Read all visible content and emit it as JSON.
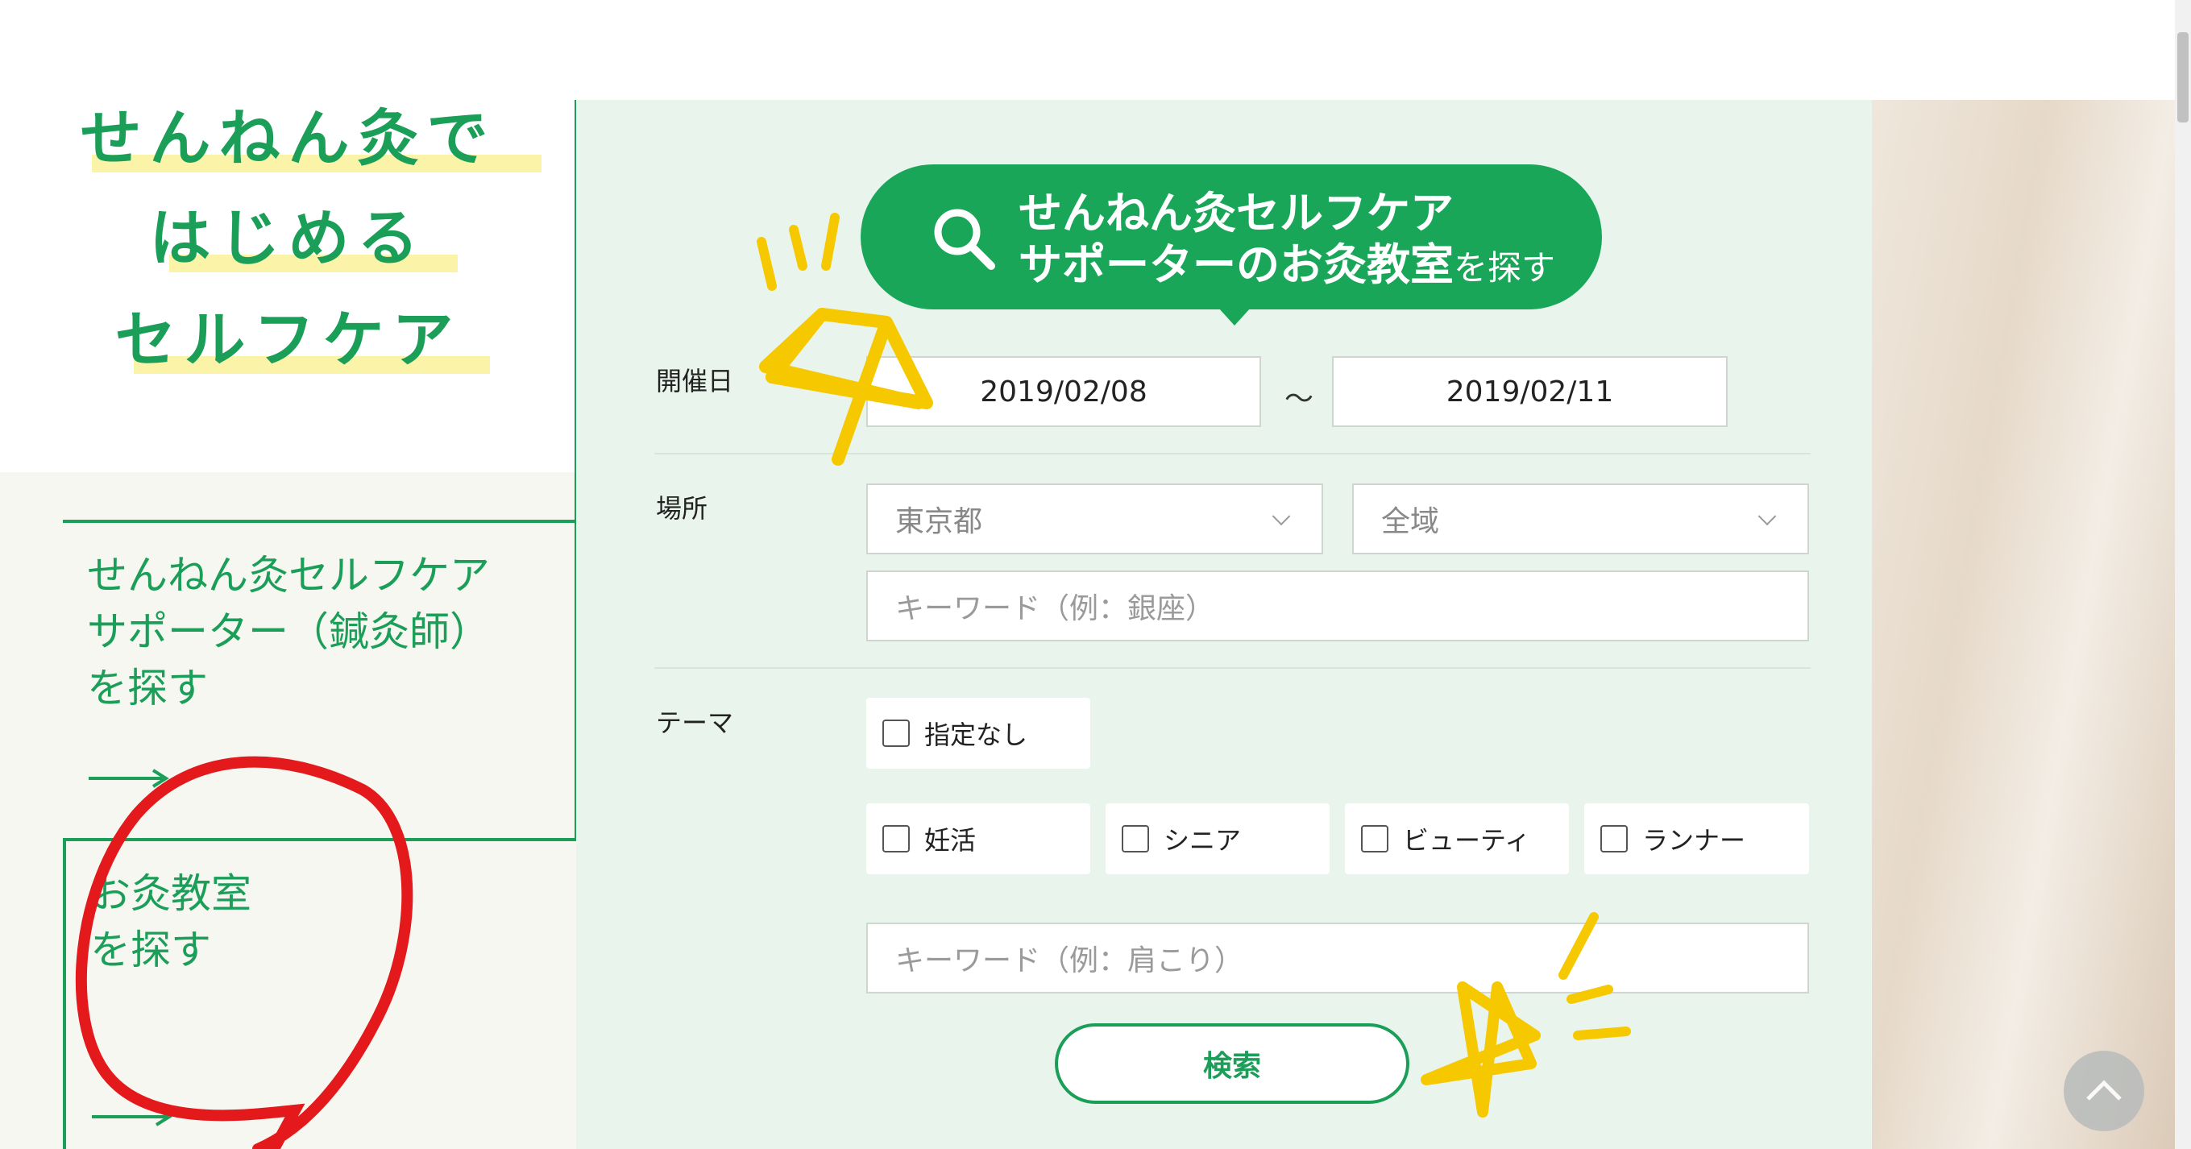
{
  "brand": {
    "line1": "せんねん灸で",
    "line2": "はじめる",
    "line3": "セルフケア"
  },
  "nav": {
    "supporter_link": "せんねん灸セルフケア\nサポーター（鍼灸師）\nを探す",
    "classroom_link": "お灸教室\nを探す"
  },
  "search_header": {
    "line1": "せんねん灸セルフケア",
    "line2": "サポーターのお灸教室",
    "line2_suffix": "を探す"
  },
  "form": {
    "date_label": "開催日",
    "date_from": "2019/02/08",
    "date_sep": "～",
    "date_to": "2019/02/11",
    "place_label": "場所",
    "prefecture": "東京都",
    "area": "全域",
    "place_keyword_placeholder": "キーワード（例：銀座）",
    "theme_label": "テーマ",
    "themes": [
      "指定なし",
      "妊活",
      "シニア",
      "ビューティ",
      "ランナー"
    ],
    "theme_keyword_placeholder": "キーワード（例：肩こり）",
    "search_button": "検索"
  },
  "colors": {
    "brand_green": "#1a9e58",
    "panel_bg": "#e9f5ec",
    "highlight_yellow": "#faf3a8",
    "annotation_red": "#e3191c",
    "annotation_yellow": "#f6c800"
  },
  "icons": [
    "search-icon",
    "arrow-right-icon",
    "chevron-down-icon",
    "chevron-up-icon"
  ]
}
